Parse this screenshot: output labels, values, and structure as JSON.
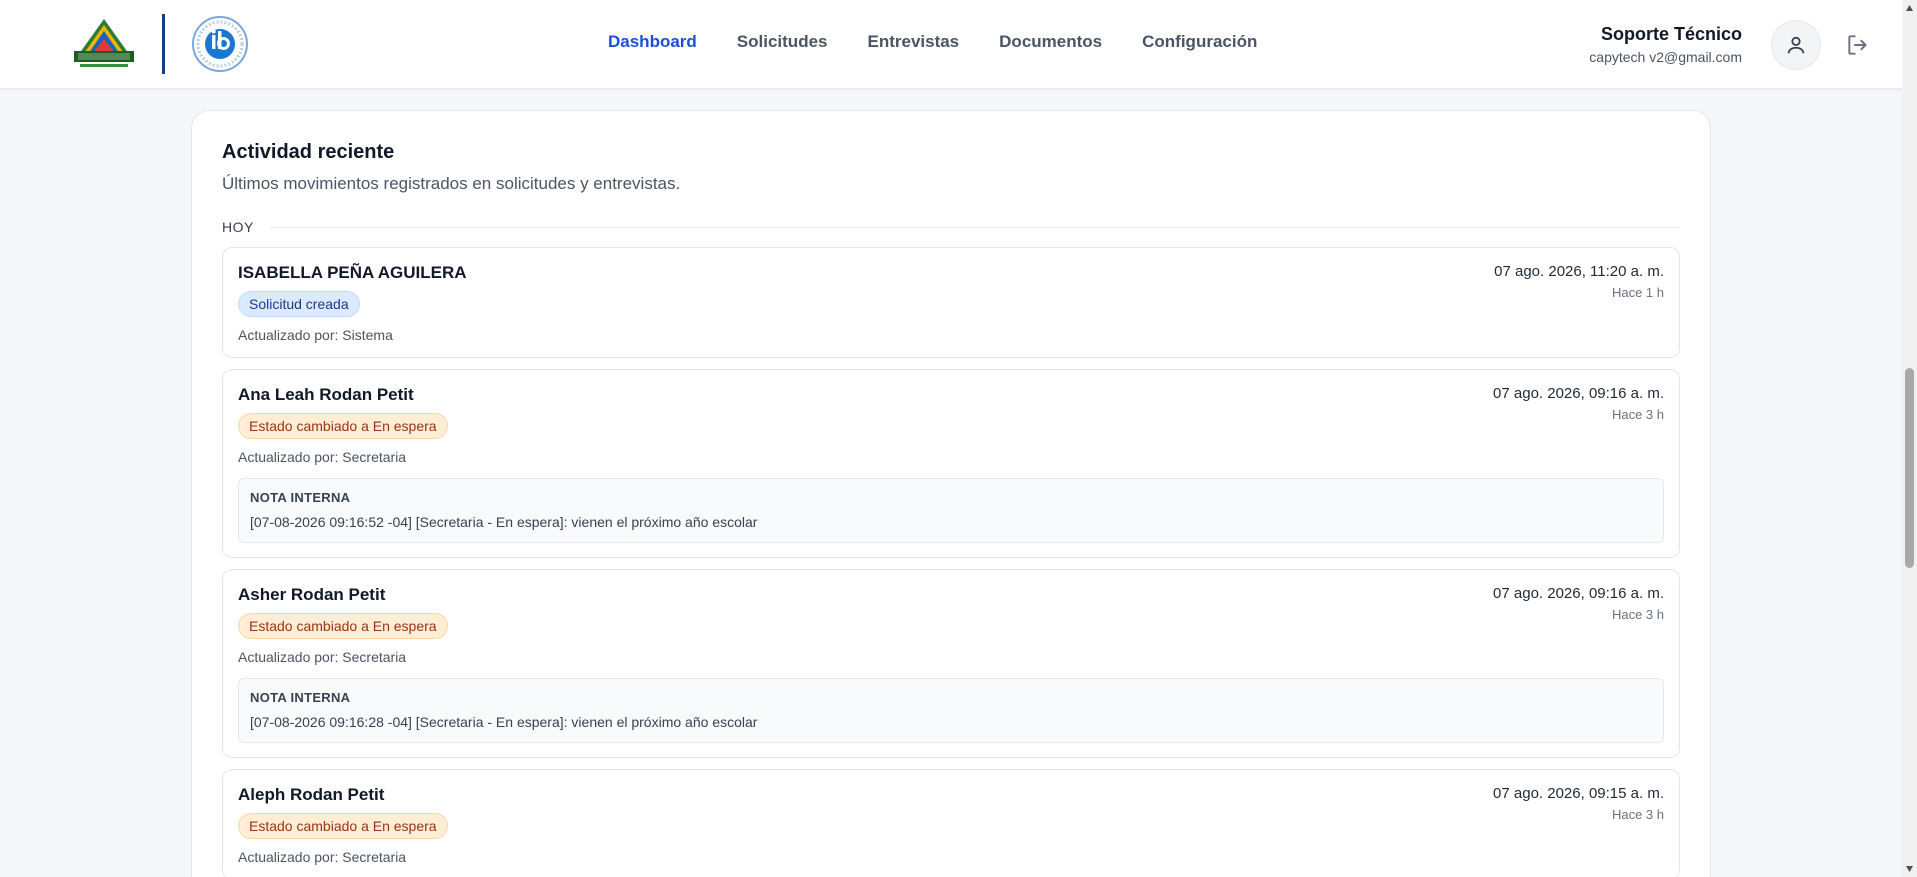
{
  "header": {
    "nav": [
      {
        "label": "Dashboard",
        "active": true
      },
      {
        "label": "Solicitudes",
        "active": false
      },
      {
        "label": "Entrevistas",
        "active": false
      },
      {
        "label": "Documentos",
        "active": false
      },
      {
        "label": "Configuración",
        "active": false
      }
    ],
    "user": {
      "name": "Soporte Técnico",
      "email": "capytech v2@gmail.com"
    }
  },
  "activity": {
    "title": "Actividad reciente",
    "subtitle": "Últimos movimientos registrados en solicitudes y entrevistas.",
    "group_label": "HOY",
    "entries": [
      {
        "name": "ISABELLA PEÑA AGUILERA",
        "badge": "Solicitud creada",
        "updated_by": "Actualizado por: Sistema",
        "date": "07 ago. 2026, 11:20 a. m.",
        "relative": "Hace 1 h"
      },
      {
        "name": "Ana Leah Rodan Petit",
        "badge": "Estado cambiado a En espera",
        "updated_by": "Actualizado por: Secretaria",
        "date": "07 ago. 2026, 09:16 a. m.",
        "relative": "Hace 3 h",
        "note_title": "NOTA INTERNA",
        "note_text": "[07-08-2026 09:16:52 -04] [Secretaria - En espera]: vienen el próximo año escolar"
      },
      {
        "name": "Asher Rodan Petit",
        "badge": "Estado cambiado a En espera",
        "updated_by": "Actualizado por: Secretaria",
        "date": "07 ago. 2026, 09:16 a. m.",
        "relative": "Hace 3 h",
        "note_title": "NOTA INTERNA",
        "note_text": "[07-08-2026 09:16:28 -04] [Secretaria - En espera]: vienen el próximo año escolar"
      },
      {
        "name": "Aleph Rodan Petit",
        "badge": "Estado cambiado a En espera",
        "updated_by": "Actualizado por: Secretaria",
        "date": "07 ago. 2026, 09:15 a. m.",
        "relative": "Hace 3 h"
      }
    ]
  },
  "colors": {
    "accent": "#1d4ed8",
    "badge_blue_bg": "#dbeafe",
    "badge_orange_bg": "#ffedd5"
  },
  "icons": {
    "avatar": "user-icon",
    "logout": "logout-icon",
    "logo_school": "school-logo-icon",
    "logo_ib": "ib-logo-icon"
  }
}
